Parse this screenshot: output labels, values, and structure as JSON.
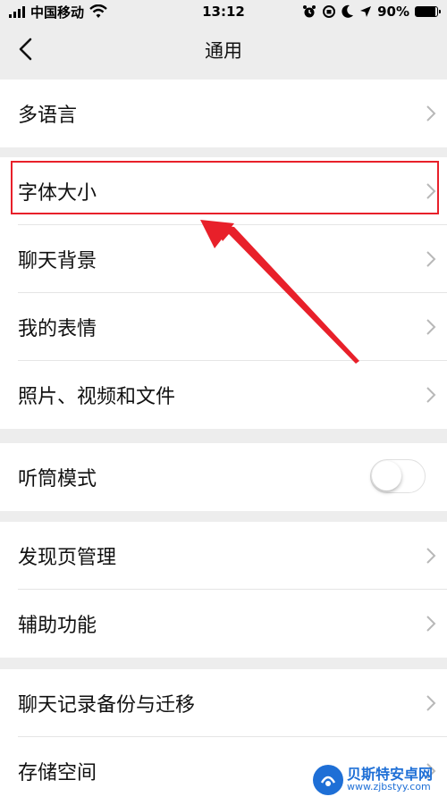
{
  "status_bar": {
    "carrier": "中国移动",
    "time": "13:12",
    "battery_percent": "90%",
    "battery_level": 0.9
  },
  "nav": {
    "title": "通用",
    "back_icon": "chevron-left-icon"
  },
  "groups": [
    {
      "items": [
        {
          "label": "多语言"
        }
      ]
    },
    {
      "items": [
        {
          "label": "字体大小"
        },
        {
          "label": "聊天背景"
        },
        {
          "label": "我的表情"
        },
        {
          "label": "照片、视频和文件"
        }
      ]
    },
    {
      "items": [
        {
          "label": "听筒模式",
          "toggle": false
        }
      ]
    },
    {
      "items": [
        {
          "label": "发现页管理"
        },
        {
          "label": "辅助功能"
        }
      ]
    },
    {
      "items": [
        {
          "label": "聊天记录备份与迁移"
        },
        {
          "label": "存储空间"
        }
      ]
    }
  ],
  "annotation": {
    "color": "#e8202a"
  },
  "watermark": {
    "name": "贝斯特安卓网",
    "url": "www.zjbstyy.com"
  }
}
